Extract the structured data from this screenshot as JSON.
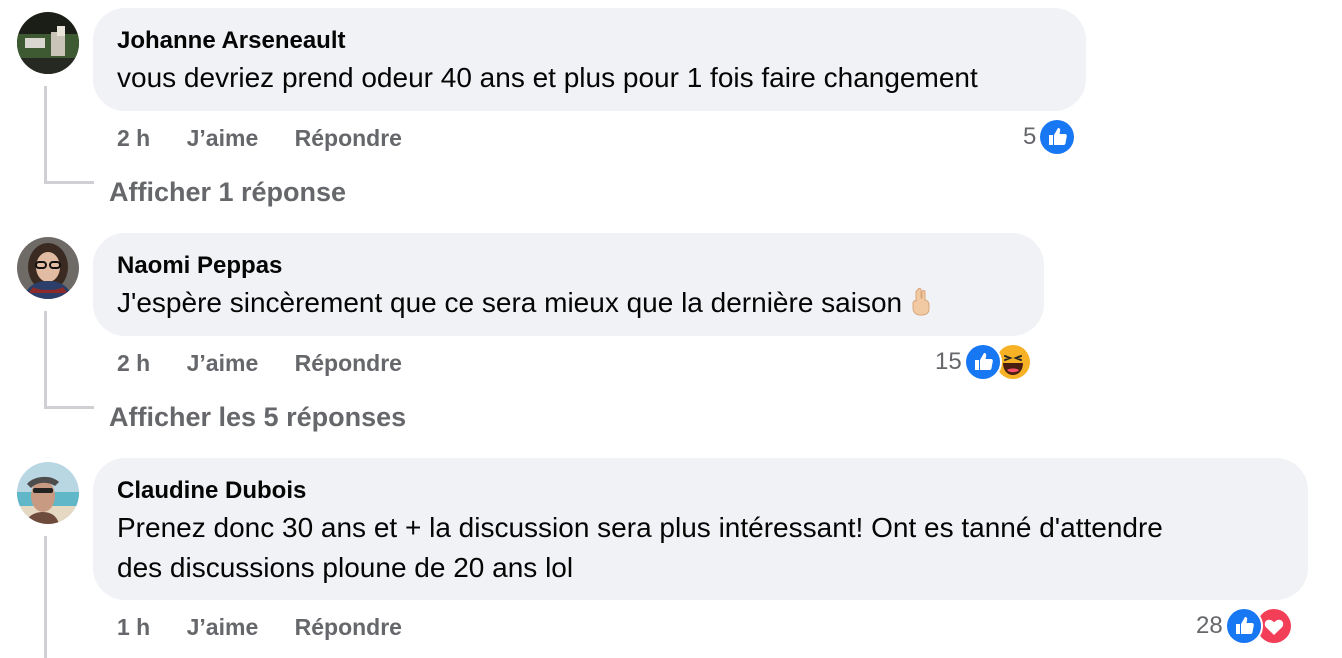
{
  "comments": [
    {
      "author": "Johanne Arseneault",
      "text": "vous devriez prend odeur 40 ans et plus pour 1 fois faire changement",
      "time": "2 h",
      "like_label": "J’aime",
      "reply_label": "Répondre",
      "reaction_count": "5",
      "reactions": [
        "like-icon"
      ],
      "view_replies": "Afficher 1 réponse"
    },
    {
      "author": "Naomi Peppas",
      "text": "J'espère sincèrement que ce sera mieux que la dernière saison",
      "text_emoji": "crossed-fingers-emoji",
      "time": "2 h",
      "like_label": "J’aime",
      "reply_label": "Répondre",
      "reaction_count": "15",
      "reactions": [
        "like-icon",
        "haha-icon"
      ],
      "view_replies": "Afficher les 5 réponses"
    },
    {
      "author": "Claudine Dubois",
      "text_line1": "Prenez donc 30 ans et + la discussion sera plus intéressant! Ont es tanné d'attendre",
      "text_line2": "des discussions ploune de 20 ans lol",
      "time": "1 h",
      "like_label": "J’aime",
      "reply_label": "Répondre",
      "reaction_count": "28",
      "reactions": [
        "like-icon",
        "love-icon"
      ]
    }
  ],
  "colors": {
    "bubble": "#f0f2f5",
    "meta_text": "#65676b",
    "like_blue": "#1877f2",
    "love_red": "#f33e58",
    "haha_yellow": "#f7b125",
    "thread_line": "#ced0d4"
  }
}
